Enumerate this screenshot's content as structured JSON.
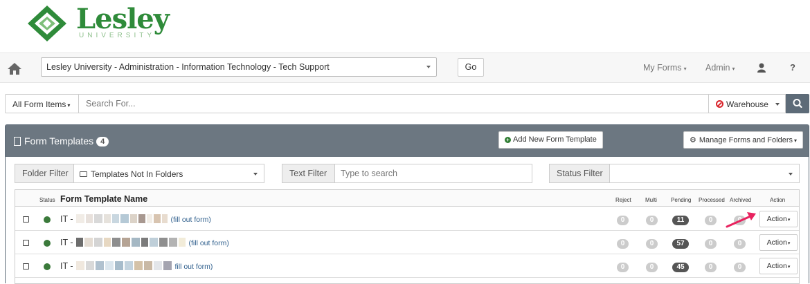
{
  "brand": {
    "name": "Lesley",
    "sub": "UNIVERSITY",
    "green": "#2f8b3a"
  },
  "nav": {
    "department": "Lesley University - Administration - Information Technology - Tech Support",
    "go": "Go",
    "my_forms": "My Forms",
    "admin": "Admin",
    "help": "?"
  },
  "search": {
    "filter": "All Form Items",
    "placeholder": "Search For...",
    "warehouse": "Warehouse"
  },
  "panel": {
    "title": "Form Templates",
    "count": "4",
    "add_button": "Add New Form Template",
    "manage_button": "Manage Forms and Folders",
    "header_color": "#6c7781"
  },
  "filters": {
    "folder_label": "Folder Filter",
    "folder_value": "Templates Not In Folders",
    "text_label": "Text Filter",
    "text_placeholder": "Type to search",
    "status_label": "Status Filter",
    "status_value": ""
  },
  "table": {
    "headers": {
      "status": "Status",
      "name": "Form Template Name",
      "reject": "Reject",
      "multi": "Multi",
      "pending": "Pending",
      "processed": "Processed",
      "archived": "Archived",
      "action": "Action"
    },
    "rows": [
      {
        "prefix": "IT -",
        "link": "(fill out form)",
        "reject": "0",
        "multi": "0",
        "pending": "11",
        "processed": "0",
        "archived": "0",
        "action": "Action"
      },
      {
        "prefix": "IT -",
        "link": "(fill out form)",
        "reject": "0",
        "multi": "0",
        "pending": "57",
        "processed": "0",
        "archived": "0",
        "action": "Action"
      },
      {
        "prefix": "IT -",
        "link": "fill out form)",
        "reject": "0",
        "multi": "0",
        "pending": "45",
        "processed": "0",
        "archived": "0",
        "action": "Action"
      }
    ]
  }
}
